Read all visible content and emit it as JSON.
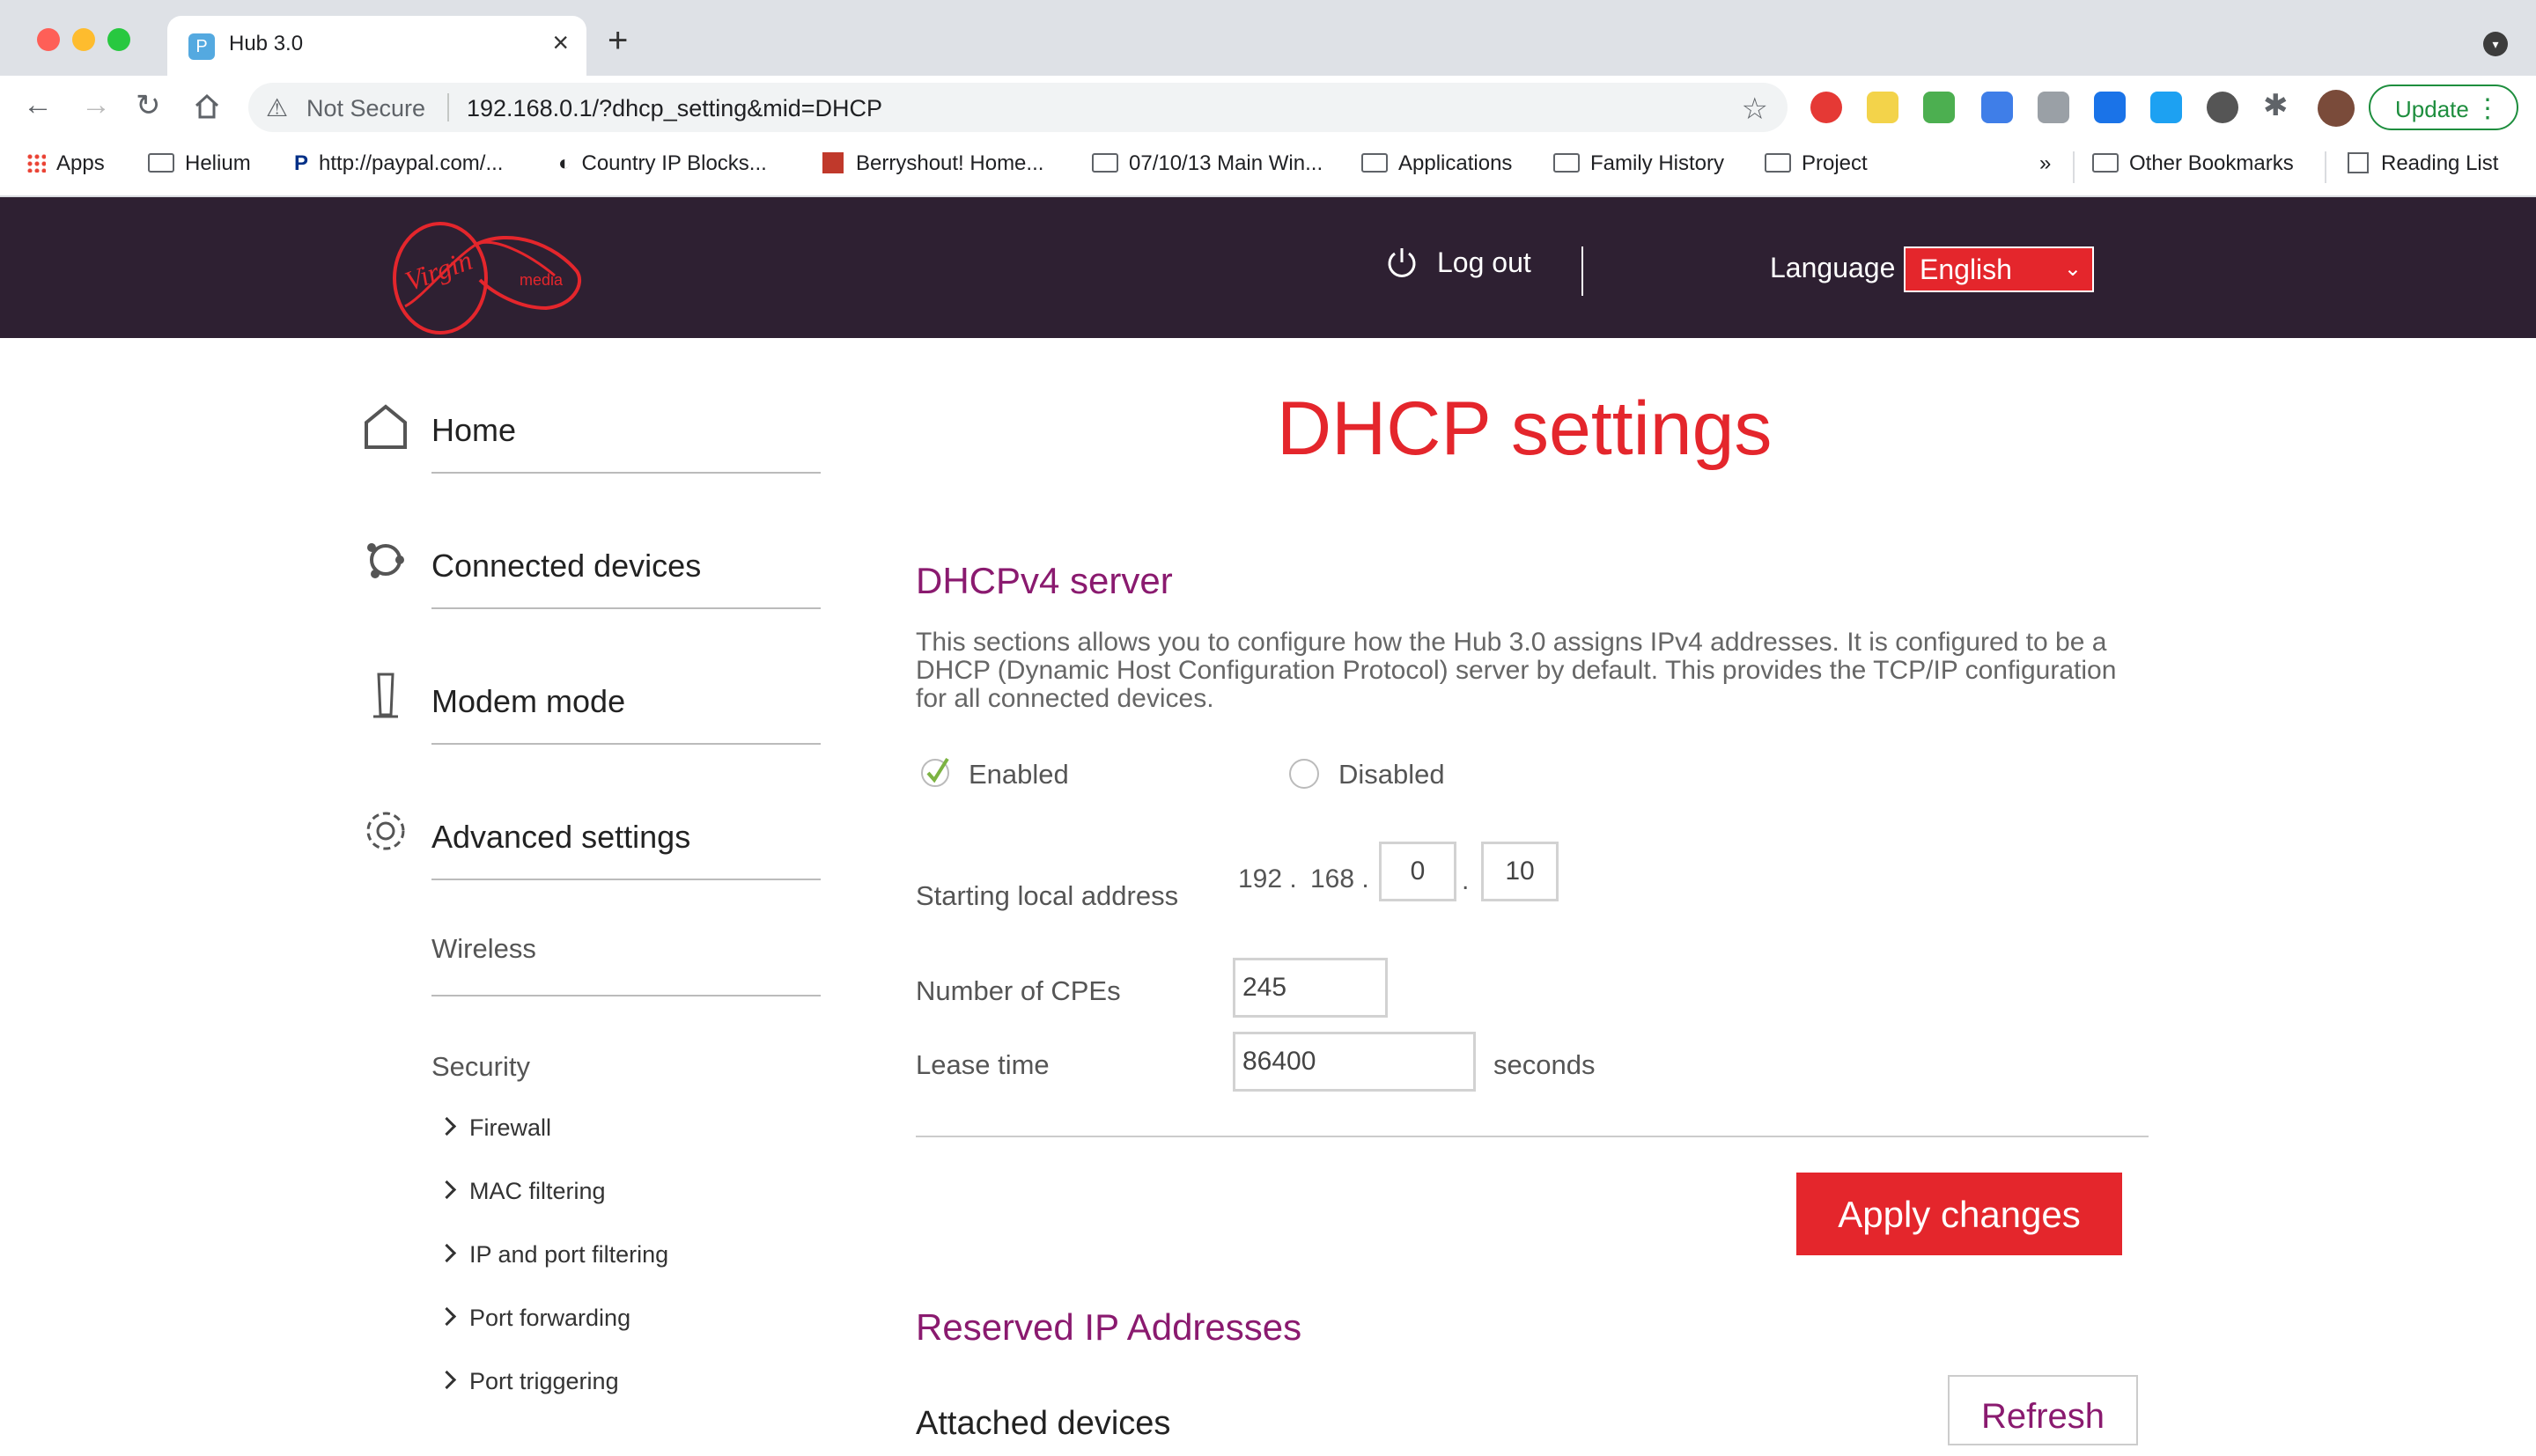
{
  "browser": {
    "tab_title": "Hub 3.0",
    "security_label": "Not Secure",
    "url": "192.168.0.1/?dhcp_setting&mid=DHCP",
    "update_label": "Update",
    "bookmarks": [
      {
        "label": "Apps",
        "icon": "apps-grid-icon"
      },
      {
        "label": "Helium",
        "icon": "folder-icon"
      },
      {
        "label": "http://paypal.com/...",
        "icon": "paypal-icon"
      },
      {
        "label": "Country IP Blocks...",
        "icon": "globe-icon"
      },
      {
        "label": "Berryshout! Home...",
        "icon": "site-icon"
      },
      {
        "label": "07/10/13 Main Win...",
        "icon": "folder-icon"
      },
      {
        "label": "Applications",
        "icon": "folder-icon"
      },
      {
        "label": "Family History",
        "icon": "folder-icon"
      },
      {
        "label": "Project",
        "icon": "folder-icon"
      },
      {
        "label": "»",
        "icon": "overflow-icon"
      },
      {
        "label": "Other Bookmarks",
        "icon": "folder-icon"
      },
      {
        "label": "Reading List",
        "icon": "reading-list-icon"
      }
    ]
  },
  "header": {
    "logout_label": "Log out",
    "language_label": "Language",
    "language_value": "English"
  },
  "sidebar": {
    "items": [
      {
        "label": "Home",
        "icon": "home-icon"
      },
      {
        "label": "Connected devices",
        "icon": "devices-icon"
      },
      {
        "label": "Modem mode",
        "icon": "modem-icon"
      },
      {
        "label": "Advanced settings",
        "icon": "gear-icon"
      }
    ],
    "wireless_label": "Wireless",
    "security_label": "Security",
    "security_items": [
      "Firewall",
      "MAC filtering",
      "IP and port filtering",
      "Port forwarding",
      "Port triggering"
    ]
  },
  "main": {
    "title": "DHCP settings",
    "dhcpv4_heading": "DHCPv4 server",
    "description": "This sections allows you to configure how the Hub 3.0 assigns IPv4 addresses. It is configured to be a DHCP (Dynamic Host Configuration Protocol) server by default. This provides the TCP/IP configuration for all connected devices.",
    "enabled_label": "Enabled",
    "disabled_label": "Disabled",
    "starting_address_label": "Starting local address",
    "ip_octet1": "192 .",
    "ip_octet2": "168 .",
    "ip_octet3": "0",
    "ip_octet4": "10",
    "ip_dot": ".",
    "cpes_label": "Number of CPEs",
    "cpes_value": "245",
    "lease_label": "Lease time",
    "lease_value": "86400",
    "lease_unit": "seconds",
    "apply_label": "Apply changes",
    "reserved_heading": "Reserved IP Addresses",
    "attached_label": "Attached devices",
    "refresh_label": "Refresh"
  },
  "colors": {
    "brand_red": "#e4262c",
    "header_bg": "#2e2032",
    "heading_purple": "#8a1a6f"
  }
}
